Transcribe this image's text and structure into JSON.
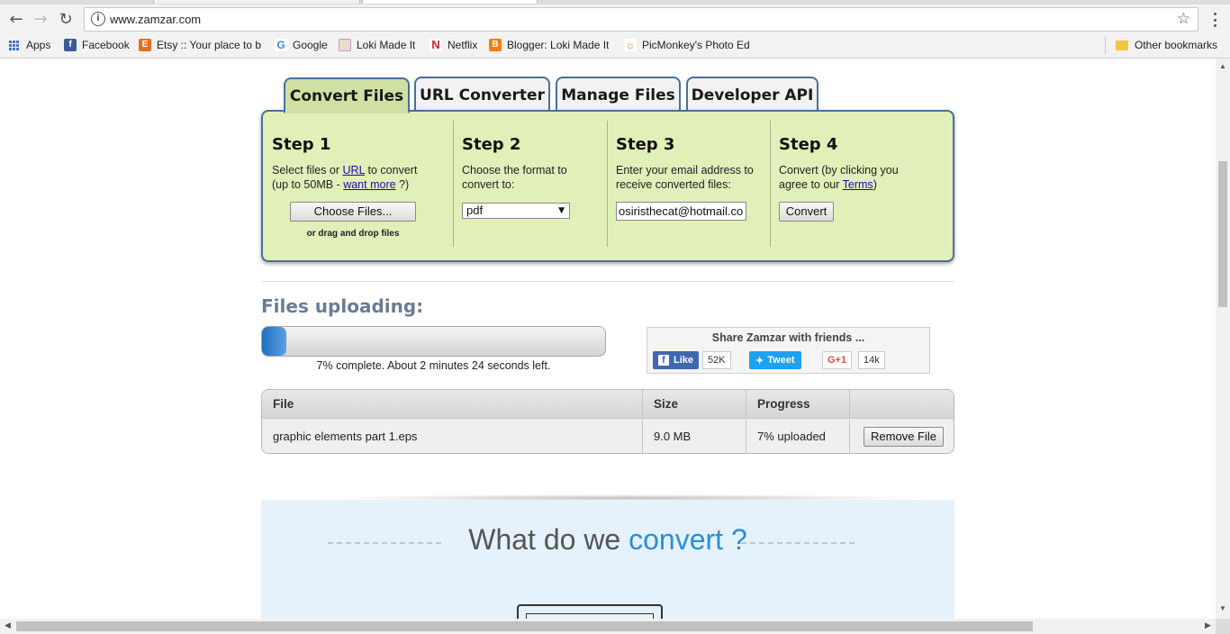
{
  "browser": {
    "url": "www.zamzar.com",
    "bookmarks": [
      {
        "label": "Apps",
        "icon": "apps-grid-icon"
      },
      {
        "label": "Facebook",
        "icon": "facebook-icon",
        "color": "#3b5998"
      },
      {
        "label": "Etsy :: Your place to bu",
        "icon": "etsy-icon",
        "color": "#e56e1a"
      },
      {
        "label": "Google",
        "icon": "google-icon"
      },
      {
        "label": "Loki Made It",
        "icon": "loki-icon"
      },
      {
        "label": "Netflix",
        "icon": "netflix-icon",
        "color": "#d81f26"
      },
      {
        "label": "Blogger: Loki Made It",
        "icon": "blogger-icon",
        "color": "#f57d00"
      },
      {
        "label": "PicMonkey's Photo Ed",
        "icon": "picmonkey-icon"
      }
    ],
    "other_bookmarks": "Other bookmarks"
  },
  "tabs": [
    {
      "label": "Convert Files",
      "active": true
    },
    {
      "label": "URL Converter",
      "active": false
    },
    {
      "label": "Manage Files",
      "active": false
    },
    {
      "label": "Developer API",
      "active": false
    }
  ],
  "steps": {
    "s1": {
      "title": "Step 1",
      "text_a": "Select files or ",
      "link_url": "URL",
      "text_b": " to convert",
      "text_c": "(up to 50MB - ",
      "link_more": "want more",
      "text_d": " ?)",
      "button": "Choose Files...",
      "hint": "or drag and drop files"
    },
    "s2": {
      "title": "Step 2",
      "text": "Choose the format to convert to:",
      "format": "pdf"
    },
    "s3": {
      "title": "Step 3",
      "text": "Enter your email address to receive converted files:",
      "email": "osiristhecat@hotmail.co"
    },
    "s4": {
      "title": "Step 4",
      "text_a": "Convert (by clicking you agree to our ",
      "link_terms": "Terms",
      "text_b": ")",
      "button": "Convert"
    }
  },
  "upload": {
    "title": "Files uploading:",
    "progress": 0.07,
    "status": "7% complete. About 2 minutes 24 seconds left."
  },
  "share": {
    "title": "Share Zamzar with friends ...",
    "like": "Like",
    "like_count": "52K",
    "tweet": "Tweet",
    "gplus": "G+1",
    "gplus_count": "14k"
  },
  "files_table": {
    "headers": [
      "File",
      "Size",
      "Progress",
      ""
    ],
    "rows": [
      {
        "file": "graphic elements part 1.eps",
        "size": "9.0 MB",
        "progress": "7% uploaded",
        "action": "Remove File"
      }
    ]
  },
  "what": {
    "text_a": "What do we ",
    "text_b": "convert ?"
  },
  "colors": {
    "panel": "#e1efb9",
    "active_tab": "#cfe0a4",
    "border": "#4a6f99",
    "progress": "#1f6fbf",
    "accent": "#2a8fd6"
  }
}
